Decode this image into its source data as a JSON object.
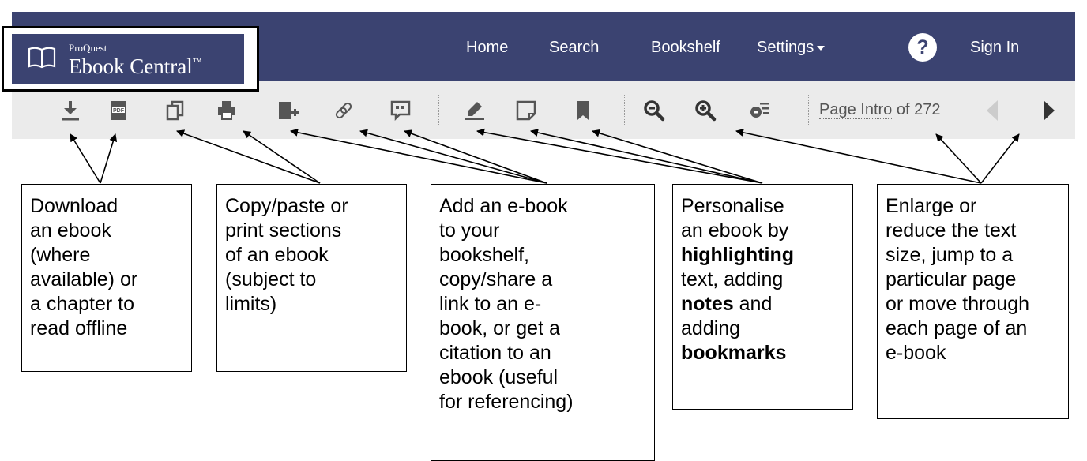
{
  "logo": {
    "small_text": "ProQuest",
    "big_text": "Ebook Central",
    "tm": "™"
  },
  "nav": {
    "home": "Home",
    "search": "Search",
    "bookshelf": "Bookshelf",
    "settings": "Settings",
    "help_glyph": "?",
    "sign_in": "Sign In"
  },
  "toolbar": {
    "icons": [
      "download-icon",
      "pdf-icon",
      "copy-icon",
      "print-icon",
      "add-to-bookshelf-icon",
      "link-icon",
      "citation-icon",
      "highlight-icon",
      "note-icon",
      "bookmark-icon",
      "zoom-out-icon",
      "zoom-in-icon",
      "text-settings-icon",
      "previous-page-icon",
      "next-page-icon"
    ],
    "pdf_label": "PDF",
    "page_word": "Page",
    "page_current": "Intro",
    "page_of": "of 272"
  },
  "callouts": {
    "download": {
      "lines": [
        "Download",
        "an ebook",
        "(where",
        "available) or",
        "a chapter to",
        "read offline"
      ]
    },
    "copy_print": {
      "lines": [
        "Copy/paste or",
        "print sections",
        "of an ebook",
        "(subject to",
        "limits)"
      ]
    },
    "add_share": {
      "lines": [
        "Add an e-book",
        "to your",
        "bookshelf,",
        "copy/share a",
        "link to an e-",
        "book, or get a",
        "citation to an",
        "ebook (useful",
        "for referencing)"
      ]
    },
    "personalise": {
      "l1": "Personalise",
      "l2": "an ebook by",
      "l3_bold": "highlighting",
      "l4": "text, adding",
      "l5_bold": "notes",
      "l5_rest": " and",
      "l6": "adding",
      "l7_bold": "bookmarks"
    },
    "navigate": {
      "lines": [
        "Enlarge or",
        "reduce the text",
        "size, jump to a",
        "particular page",
        "or move through",
        "each page of an",
        "e-book"
      ]
    }
  },
  "colors": {
    "navbar": "#3b4371",
    "toolbar": "#ebebeb",
    "icon": "#555555"
  }
}
